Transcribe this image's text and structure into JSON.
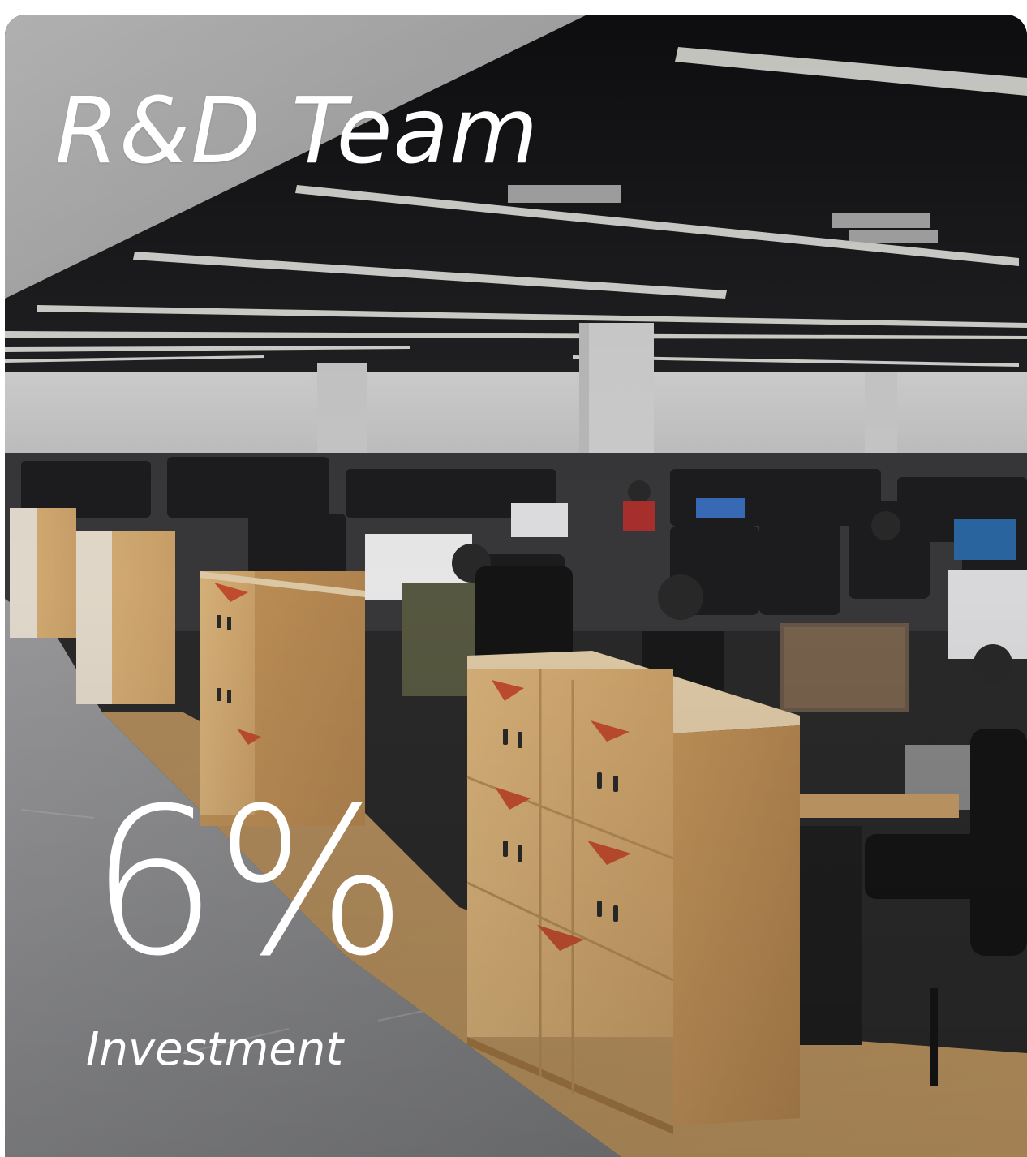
{
  "card": {
    "title": "R&D Team",
    "stat_value": "6%",
    "stat_label": "Investment",
    "background_image": "office-photo"
  },
  "colors": {
    "text": "#ffffff",
    "floor": "#8f9092",
    "ceiling": "#1b1b1d",
    "cabinet": "#d2a66d",
    "cabinet_accent": "#c8502f"
  }
}
